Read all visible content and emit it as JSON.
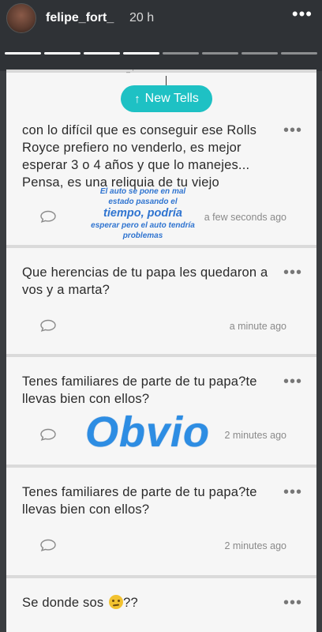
{
  "header": {
    "username": "felipe_fort_",
    "time": "20 h",
    "progress_segments": 8,
    "progress_done": 4
  },
  "card": {
    "top_fragment": "– ‘",
    "new_tells_label": "New Tells",
    "items": [
      {
        "text": "con lo difícil que es conseguir ese Rolls Royce prefiero no venderlo, es mejor esperar 3 o 4 años y que lo manejes... Pensa, es una reliquia de tu viejo",
        "timestamp": "a few seconds ago"
      },
      {
        "text": "Que herencias de tu papa les quedaron a vos y a marta?",
        "timestamp": "a minute ago"
      },
      {
        "text": "Tenes familiares de parte de tu papa?te llevas bien con ellos?",
        "timestamp": "2 minutes ago"
      },
      {
        "text": "Tenes familiares de parte de tu papa?te llevas bien con ellos?",
        "timestamp": "2 minutes ago"
      },
      {
        "text": "Se donde sos",
        "suffix": "??"
      }
    ]
  },
  "overlays": {
    "caption_line1": "El auto se pone en mal estado pasando el",
    "caption_big": "tiempo, podría",
    "caption_line3": "esperar pero el auto tendría problemas",
    "obvio": "Obvio"
  }
}
